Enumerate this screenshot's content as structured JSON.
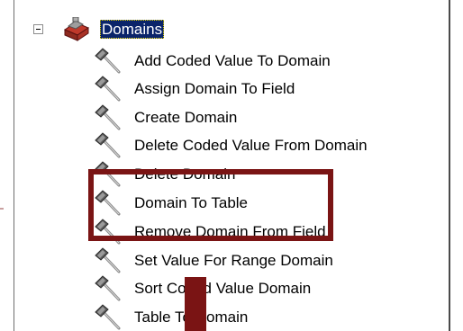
{
  "tree": {
    "root": {
      "label": "Domains",
      "expander": "minus-box",
      "icon": "toolbox-folder-icon",
      "selected": true
    },
    "items": [
      {
        "label": "Add Coded Value To Domain",
        "icon": "hammer-icon"
      },
      {
        "label": "Assign Domain To Field",
        "icon": "hammer-icon"
      },
      {
        "label": "Create Domain",
        "icon": "hammer-icon"
      },
      {
        "label": "Delete Coded Value From Domain",
        "icon": "hammer-icon"
      },
      {
        "label": "Delete Domain",
        "icon": "hammer-icon"
      },
      {
        "label": "Domain To Table",
        "icon": "hammer-icon"
      },
      {
        "label": "Remove Domain From Field",
        "icon": "hammer-icon"
      },
      {
        "label": "Set Value For Range Domain",
        "icon": "hammer-icon"
      },
      {
        "label": "Sort Coded Value Domain",
        "icon": "hammer-icon"
      },
      {
        "label": "Table To Domain",
        "icon": "hammer-icon"
      }
    ]
  },
  "colors": {
    "selection_bg": "#0a246a",
    "selection_fg": "#ffffff",
    "annotation": "#7a1414"
  }
}
